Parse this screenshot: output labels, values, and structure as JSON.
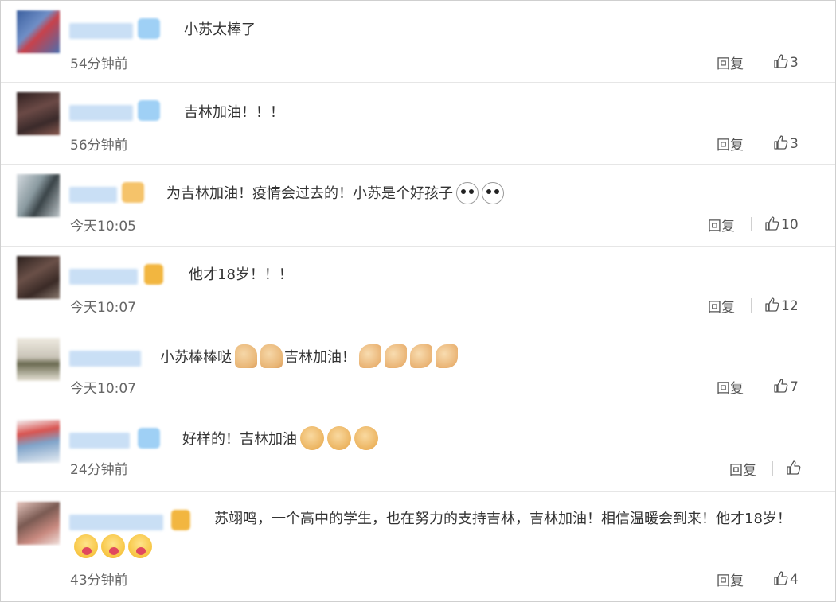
{
  "comments": [
    {
      "text": "小苏太棒了",
      "time": "54分钟前",
      "reply_label": "回复",
      "like_count": "3",
      "avatar_color": "#4a6fb0",
      "badge_color": "#9fd0f5"
    },
    {
      "text": "吉林加油！！！",
      "time": "56分钟前",
      "reply_label": "回复",
      "like_count": "3",
      "avatar_color": "#5a3a3a",
      "badge_color": "#9fd0f5"
    },
    {
      "text": "为吉林加油！疫情会过去的！小苏是个好孩子",
      "time": "今天10:05",
      "reply_label": "回复",
      "like_count": "10",
      "emojis": [
        "panda-emoji",
        "panda-emoji"
      ],
      "avatar_color": "#8a9aa0",
      "badge_color": "#f5c36a"
    },
    {
      "text": "他才18岁！！！",
      "time": "今天10:07",
      "reply_label": "回复",
      "like_count": "12",
      "avatar_color": "#4a3a38",
      "badge_color": "#f2b640"
    },
    {
      "text_a": "小苏棒棒哒",
      "text_b": "吉林加油！",
      "time": "今天10:07",
      "reply_label": "回复",
      "like_count": "7",
      "emojis_a": [
        "thumbs-up-emoji",
        "thumbs-up-emoji"
      ],
      "emojis_b": [
        "flex-arm-emoji",
        "flex-arm-emoji",
        "flex-arm-emoji",
        "flex-arm-emoji"
      ],
      "avatar_color": "#c9c4b8"
    },
    {
      "text": "好样的！吉林加油",
      "time": "24分钟前",
      "reply_label": "回复",
      "like_count": "",
      "emojis": [
        "fist-emoji",
        "fist-emoji",
        "fist-emoji"
      ],
      "avatar_color": "#7fa3c9",
      "badge_color": "#9fd0f5"
    },
    {
      "text": "苏翊鸣，一个高中的学生，也在努力的支持吉林，吉林加油！相信温暖会到来！他才18岁！",
      "time": "43分钟前",
      "reply_label": "回复",
      "like_count": "4",
      "emojis": [
        "blush-face-emoji",
        "blush-face-emoji",
        "blush-face-emoji"
      ],
      "avatar_color": "#7a5a52",
      "badge_color": "#f2b640"
    }
  ]
}
